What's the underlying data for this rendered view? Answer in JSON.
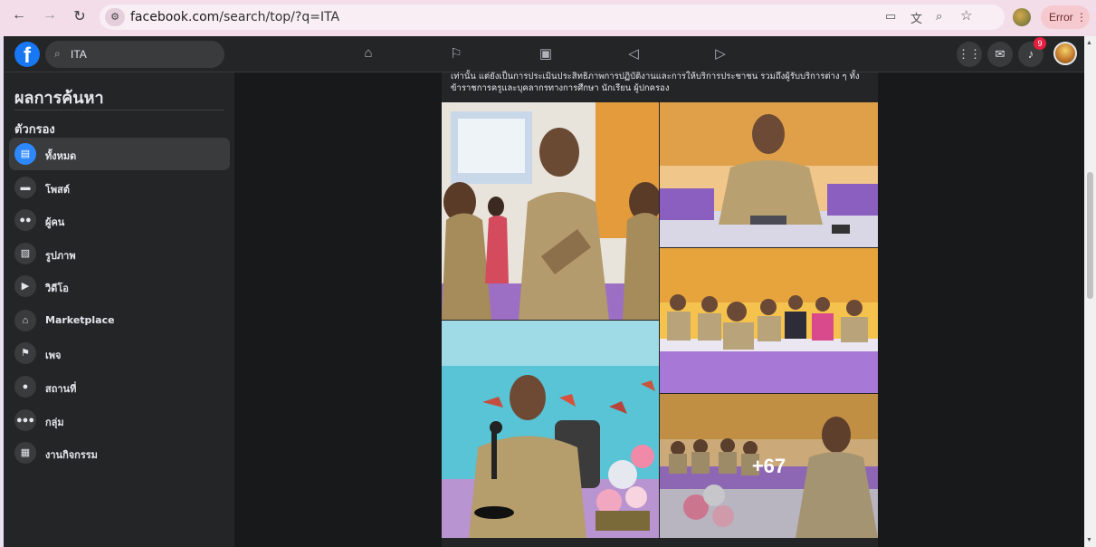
{
  "browser": {
    "url_host": "facebook.com",
    "url_path": "/search/top/?q=ITA",
    "error_label": "Error"
  },
  "header": {
    "search_value": "ITA",
    "notifications_count": "9"
  },
  "sidebar": {
    "title": "ผลการค้นหา",
    "filter_heading": "ตัวกรอง",
    "items": [
      {
        "label": "ทั้งหมด",
        "icon": "newsfeed-icon"
      },
      {
        "label": "โพสต์",
        "icon": "post-icon"
      },
      {
        "label": "ผู้คน",
        "icon": "people-icon"
      },
      {
        "label": "รูปภาพ",
        "icon": "photo-icon"
      },
      {
        "label": "วิดีโอ",
        "icon": "video-icon"
      },
      {
        "label": "Marketplace",
        "icon": "marketplace-icon"
      },
      {
        "label": "เพจ",
        "icon": "flag-icon"
      },
      {
        "label": "สถานที่",
        "icon": "place-icon"
      },
      {
        "label": "กลุ่ม",
        "icon": "groups-icon"
      },
      {
        "label": "งานกิจกรรม",
        "icon": "event-icon"
      }
    ]
  },
  "post": {
    "text": "เท่านั้น แต่ยังเป็นการประเมินประสิทธิภาพการปฏิบัติงานและการให้บริการประชาชน รวมถึงผู้รับบริการต่าง ๆ ทั้งข้าราชการครูและบุคลากรทางการศึกษา นักเรียน ผู้ปกครอง",
    "more_photos": "+67"
  },
  "colors": {
    "fb_blue": "#1877f2",
    "fb_dark": "#242526",
    "fb_bg": "#18191a",
    "notif_red": "#e41e3f"
  }
}
